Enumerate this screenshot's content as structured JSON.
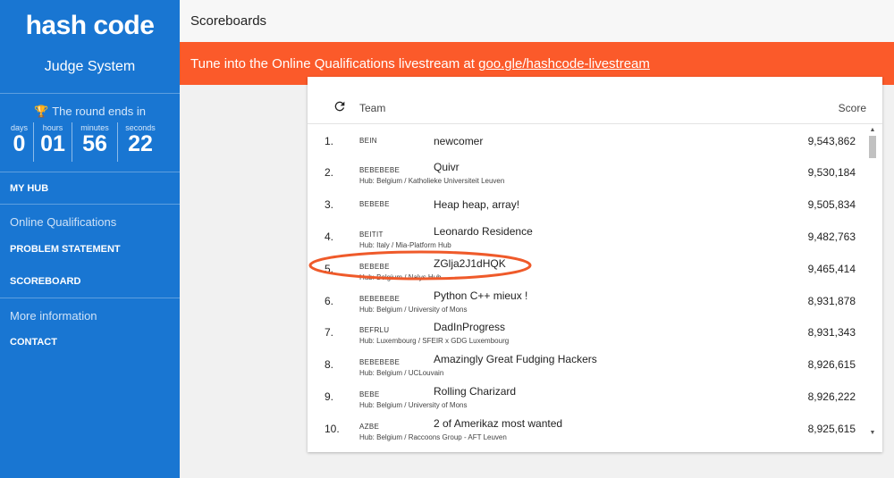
{
  "sidebar": {
    "logo": "hash code",
    "subtitle": "Judge System",
    "round_label": "The round ends in",
    "countdown": [
      {
        "unit": "days",
        "value": "0"
      },
      {
        "unit": "hours",
        "value": "01"
      },
      {
        "unit": "minutes",
        "value": "56"
      },
      {
        "unit": "seconds",
        "value": "22"
      }
    ],
    "my_hub": "MY HUB",
    "section_online": "Online Qualifications",
    "problem_statement": "PROBLEM STATEMENT",
    "scoreboard": "SCOREBOARD",
    "section_more": "More information",
    "contact": "CONTACT"
  },
  "header": {
    "title": "Scoreboards"
  },
  "banner": {
    "text": "Tune into the Online Qualifications livestream at ",
    "link": "goo.gle/hashcode-livestream",
    "color": "#fb5a2a"
  },
  "table": {
    "col_team": "Team",
    "col_score": "Score",
    "rows": [
      {
        "rank": "1.",
        "country": "BEIN",
        "name": "newcomer",
        "hub": "",
        "score": "9,543,862"
      },
      {
        "rank": "2.",
        "country": "BEBEBEBE",
        "name": "Quivr",
        "hub": "Hub: Belgium / Katholieke Universiteit Leuven",
        "score": "9,530,184"
      },
      {
        "rank": "3.",
        "country": "BEBEBE",
        "name": "Heap heap, array!",
        "hub": "",
        "score": "9,505,834"
      },
      {
        "rank": "4.",
        "country": "BEITIT",
        "name": "Leonardo Residence",
        "hub": "Hub: Italy / Mia-Platform Hub",
        "score": "9,482,763"
      },
      {
        "rank": "5.",
        "country": "BEBEBE",
        "name": "ZGlja2J1dHQK",
        "hub": "Hub: Belgium / Nalys Hub",
        "score": "9,465,414"
      },
      {
        "rank": "6.",
        "country": "BEBEBEBE",
        "name": "Python C++ mieux !",
        "hub": "Hub: Belgium / University of Mons",
        "score": "8,931,878"
      },
      {
        "rank": "7.",
        "country": "BEFRLU",
        "name": "DadInProgress",
        "hub": "Hub: Luxembourg / SFEIR x GDG Luxembourg",
        "score": "8,931,343"
      },
      {
        "rank": "8.",
        "country": "BEBEBEBE",
        "name": "Amazingly Great Fudging Hackers",
        "hub": "Hub: Belgium / UCLouvain",
        "score": "8,926,615"
      },
      {
        "rank": "9.",
        "country": "BEBE",
        "name": "Rolling Charizard",
        "hub": "Hub: Belgium / University of Mons",
        "score": "8,926,222"
      },
      {
        "rank": "10.",
        "country": "AZBE",
        "name": "2 of Amerikaz most wanted",
        "hub": "Hub: Belgium / Raccoons Group - AFT Leuven",
        "score": "8,925,615"
      }
    ]
  },
  "colors": {
    "sidebar": "#1976d2",
    "banner": "#fb5a2a",
    "highlight": "#ef5a2a",
    "trophy": "#f4c542"
  },
  "icons": {
    "trophy": "trophy-icon",
    "refresh": "refresh-icon"
  }
}
